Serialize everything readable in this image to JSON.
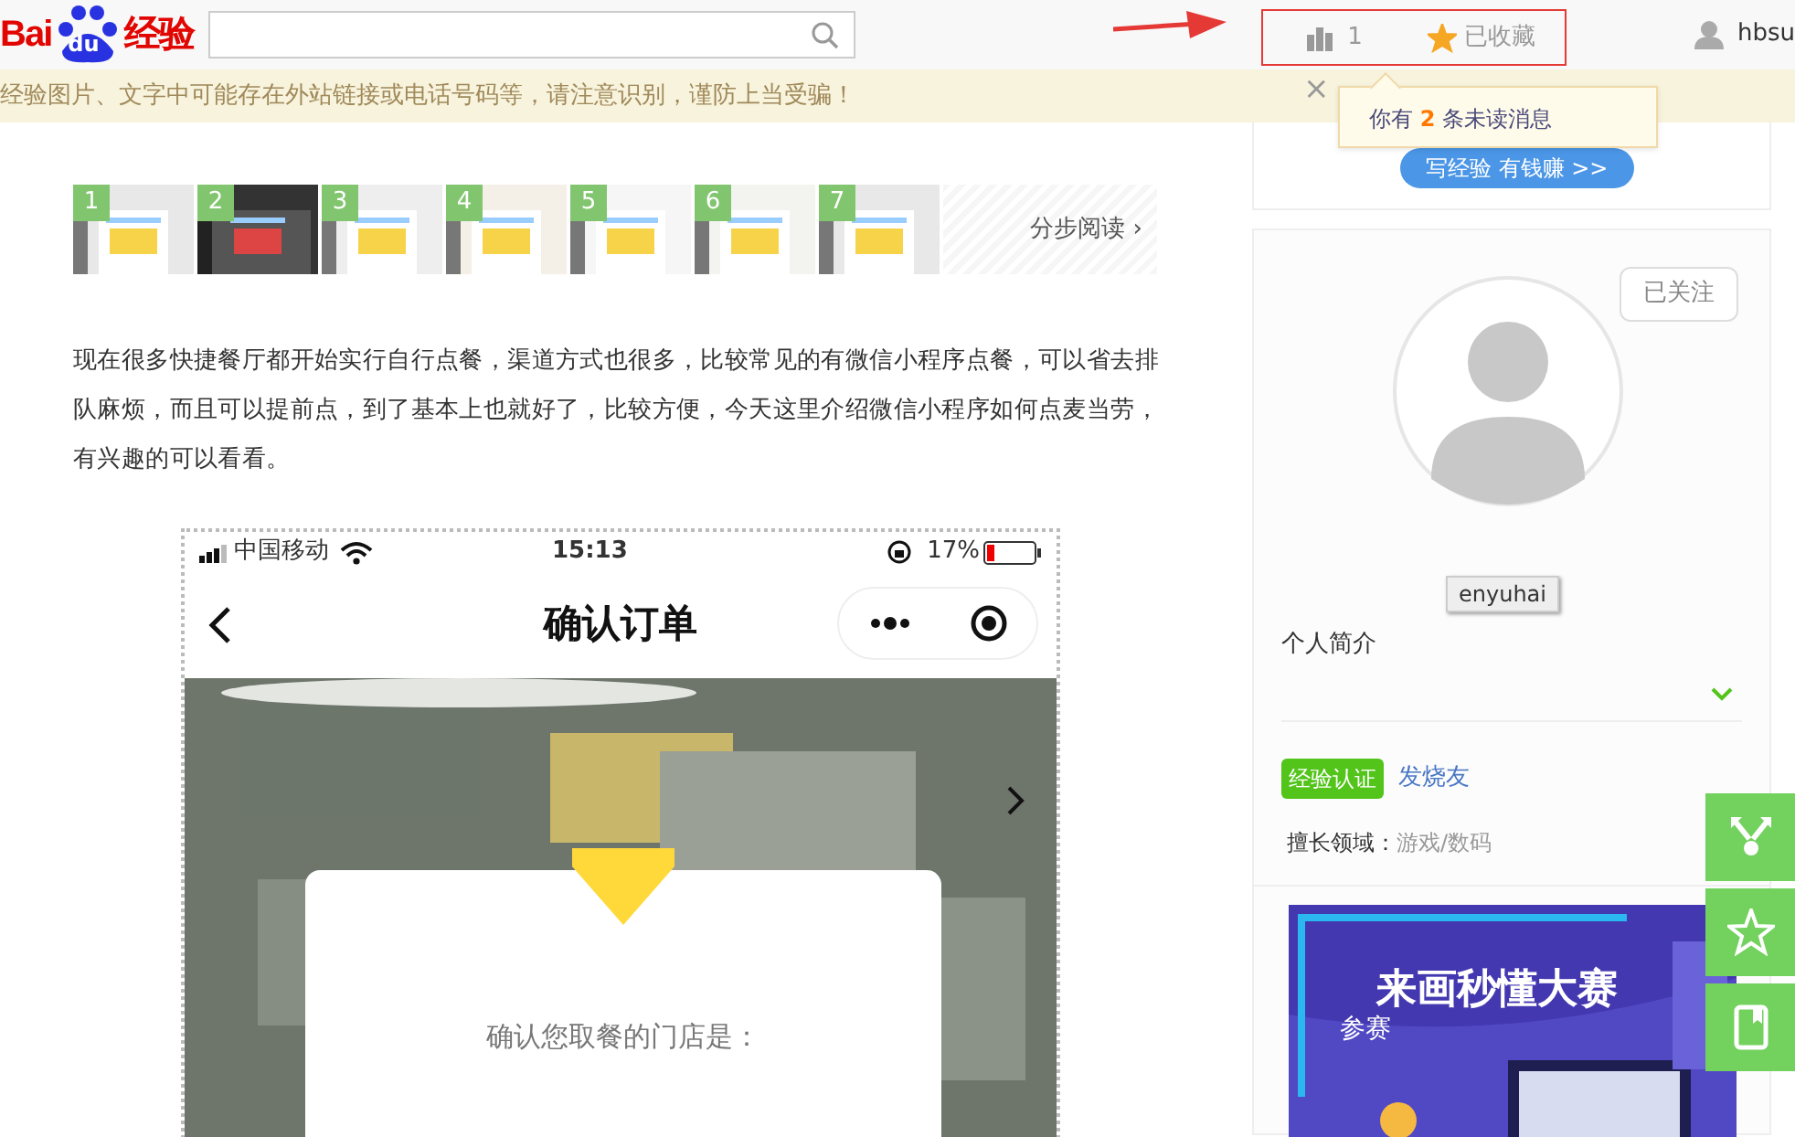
{
  "header": {
    "logo": {
      "left": "Bai",
      "paw": "du",
      "right": "经验"
    },
    "stats": {
      "views": "1",
      "favorite": {
        "label": "已收藏",
        "selected": true
      }
    },
    "user": {
      "name": "hbsu"
    }
  },
  "notice": {
    "text": "经验图片、文字中可能存在外站链接或电话号码等，请注意识别，谨防上当受骗！",
    "close": "×"
  },
  "tooltip": {
    "text": "你有 **2** 条未读消息"
  },
  "article": {
    "thumbnails": [
      {
        "number": "1"
      },
      {
        "number": "2"
      },
      {
        "number": "3"
      },
      {
        "number": "4"
      },
      {
        "number": "5"
      },
      {
        "number": "6"
      },
      {
        "number": "7"
      }
    ],
    "step_read": {
      "label": "分步阅读",
      "arrow": "›"
    },
    "paragraph": "现在很多快捷餐厅都开始实行自行点餐，渠道方式也很多，比较常见的有微信小程序点餐，可以省去排队麻烦，而且可以提前点，到了基本上也就好了，比较方便，今天这里介绍微信小程序如何点麦当劳，有兴趣的可以看看。",
    "screenshot": {
      "carrier": "中国移动",
      "time": "15:13",
      "battery": "17%",
      "title": "确认订单",
      "dialog_text": "确认您取餐的门店是："
    }
  },
  "sidebar": {
    "write_button": "写经验 有钱赚 >>",
    "profile": {
      "follow": "已关注",
      "name": "enyuhai",
      "intro_label": "个人简介",
      "badge": "经验认证",
      "level": "发烧友",
      "field_label": "擅长领域：",
      "field_value": "游戏/数码"
    },
    "banner": {
      "title": "来画秒懂大赛",
      "subtitle": "参赛"
    }
  },
  "float_buttons": [
    {
      "kind": "share"
    },
    {
      "kind": "favorite"
    },
    {
      "kind": "bookmark"
    }
  ]
}
